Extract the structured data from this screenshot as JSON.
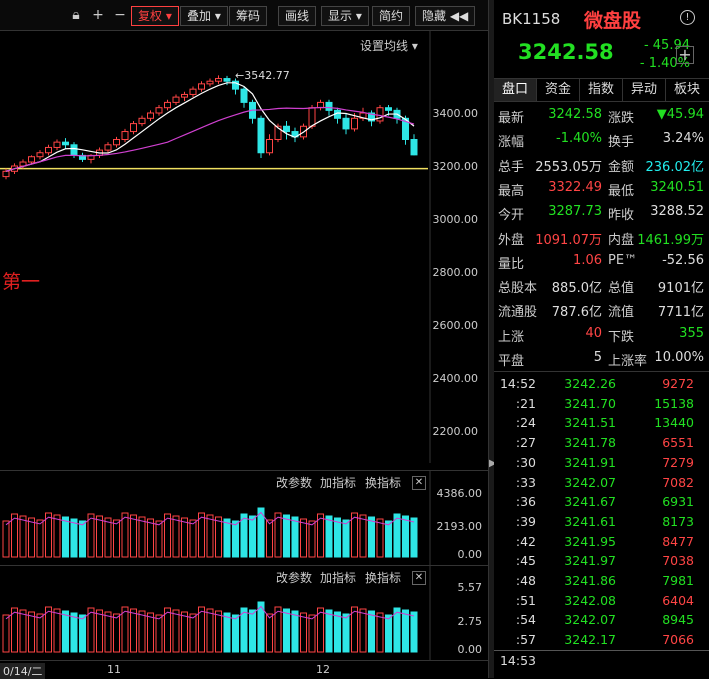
{
  "toolbar": {
    "items": [
      "复权 ▾",
      "叠加 ▾",
      "筹码",
      "画线",
      "显示 ▾",
      "简约",
      "隐藏 ◀◀"
    ],
    "lock_icon": "lock-icon",
    "plus_icon": "plus-icon",
    "minus_icon": "minus-icon"
  },
  "main_chart": {
    "ma_setting": "设置均线 ▾",
    "peak_label": "3542.77",
    "annotation": "第一",
    "y_ticks": [
      "3400.00",
      "3200.00",
      "3000.00",
      "2800.00",
      "2600.00",
      "2400.00",
      "2200.00"
    ],
    "colors": {
      "up": "#ff4545",
      "down": "#2ee6e6",
      "ma5": "#ffffff",
      "ma10": "#d040d0",
      "line": "#f0e060"
    }
  },
  "sub1": {
    "buttons": [
      "改参数",
      "加指标",
      "换指标"
    ],
    "close": "✕",
    "y_ticks": [
      "4386.00",
      "2193.00",
      "0.00"
    ]
  },
  "sub2": {
    "buttons": [
      "改参数",
      "加指标",
      "换指标"
    ],
    "close": "✕",
    "y_ticks": [
      "5.57",
      "2.75",
      "0.00"
    ]
  },
  "xaxis": {
    "date_label": "0/14/二",
    "m11": "11",
    "m12": "12"
  },
  "quote": {
    "code": "BK1158",
    "name": "微盘股",
    "info_icon": "info-icon",
    "price": "3242.58",
    "change": "- 45.94",
    "change_pct": "- 1.40%",
    "add": "+"
  },
  "tabs": [
    "盘口",
    "资金",
    "指数",
    "异动",
    "板块"
  ],
  "stats": [
    {
      "l1": "最新",
      "v1": "3242.58",
      "c1": "green",
      "l2": "涨跌",
      "v2": "▼45.94",
      "c2": "green"
    },
    {
      "l1": "涨幅",
      "v1": "-1.40%",
      "c1": "green",
      "l2": "换手",
      "v2": "3.24%",
      "c2": "white"
    },
    {
      "l1": "总手",
      "v1": "2553.05万",
      "c1": "white",
      "l2": "金额",
      "v2": "236.02亿",
      "c2": "cyan"
    },
    {
      "l1": "最高",
      "v1": "3322.49",
      "c1": "red",
      "l2": "最低",
      "v2": "3240.51",
      "c2": "green"
    },
    {
      "l1": "今开",
      "v1": "3287.73",
      "c1": "green",
      "l2": "昨收",
      "v2": "3288.52",
      "c2": "white"
    },
    {
      "l1": "外盘",
      "v1": "1091.07万",
      "c1": "red",
      "l2": "内盘",
      "v2": "1461.99万",
      "c2": "green"
    },
    {
      "l1": "量比",
      "v1": "1.06",
      "c1": "red",
      "l2": "PE™",
      "v2": "-52.56",
      "c2": "white"
    },
    {
      "l1": "总股本",
      "v1": "885.0亿",
      "c1": "white",
      "l2": "总值",
      "v2": "9101亿",
      "c2": "white"
    },
    {
      "l1": "流通股",
      "v1": "787.6亿",
      "c1": "white",
      "l2": "流值",
      "v2": "7711亿",
      "c2": "white"
    },
    {
      "l1": "上涨",
      "v1": "40",
      "c1": "red",
      "l2": "下跌",
      "v2": "355",
      "c2": "green"
    },
    {
      "l1": "平盘",
      "v1": "5",
      "c1": "white",
      "l2": "上涨率",
      "v2": "10.00%",
      "c2": "white"
    }
  ],
  "ticks": [
    {
      "t": "14:52",
      "p": "3242.26",
      "v": "9272",
      "pc": "green",
      "vc": "red"
    },
    {
      "t": ":21",
      "p": "3241.70",
      "v": "15138",
      "pc": "green",
      "vc": "green"
    },
    {
      "t": ":24",
      "p": "3241.51",
      "v": "13440",
      "pc": "green",
      "vc": "green"
    },
    {
      "t": ":27",
      "p": "3241.78",
      "v": "6551",
      "pc": "green",
      "vc": "red"
    },
    {
      "t": ":30",
      "p": "3241.91",
      "v": "7279",
      "pc": "green",
      "vc": "red"
    },
    {
      "t": ":33",
      "p": "3242.07",
      "v": "7082",
      "pc": "green",
      "vc": "red"
    },
    {
      "t": ":36",
      "p": "3241.67",
      "v": "6931",
      "pc": "green",
      "vc": "green"
    },
    {
      "t": ":39",
      "p": "3241.61",
      "v": "8173",
      "pc": "green",
      "vc": "green"
    },
    {
      "t": ":42",
      "p": "3241.95",
      "v": "8477",
      "pc": "green",
      "vc": "red"
    },
    {
      "t": ":45",
      "p": "3241.97",
      "v": "7038",
      "pc": "green",
      "vc": "red"
    },
    {
      "t": ":48",
      "p": "3241.86",
      "v": "7981",
      "pc": "green",
      "vc": "green"
    },
    {
      "t": ":51",
      "p": "3242.08",
      "v": "6404",
      "pc": "green",
      "vc": "red"
    },
    {
      "t": ":54",
      "p": "3242.07",
      "v": "8945",
      "pc": "green",
      "vc": "green"
    },
    {
      "t": ":57",
      "p": "3242.17",
      "v": "7066",
      "pc": "green",
      "vc": "red"
    },
    {
      "t": "14:53",
      "p": "",
      "v": "",
      "pc": "white",
      "vc": "white"
    }
  ]
}
